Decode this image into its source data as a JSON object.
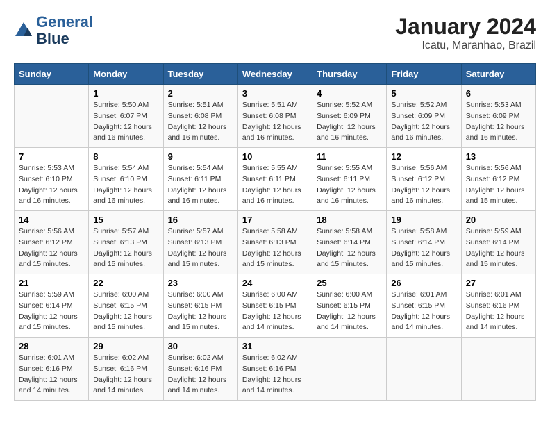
{
  "logo": {
    "line1": "General",
    "line2": "Blue"
  },
  "title": "January 2024",
  "location": "Icatu, Maranhao, Brazil",
  "days_header": [
    "Sunday",
    "Monday",
    "Tuesday",
    "Wednesday",
    "Thursday",
    "Friday",
    "Saturday"
  ],
  "weeks": [
    [
      {
        "num": "",
        "info": ""
      },
      {
        "num": "1",
        "info": "Sunrise: 5:50 AM\nSunset: 6:07 PM\nDaylight: 12 hours\nand 16 minutes."
      },
      {
        "num": "2",
        "info": "Sunrise: 5:51 AM\nSunset: 6:08 PM\nDaylight: 12 hours\nand 16 minutes."
      },
      {
        "num": "3",
        "info": "Sunrise: 5:51 AM\nSunset: 6:08 PM\nDaylight: 12 hours\nand 16 minutes."
      },
      {
        "num": "4",
        "info": "Sunrise: 5:52 AM\nSunset: 6:09 PM\nDaylight: 12 hours\nand 16 minutes."
      },
      {
        "num": "5",
        "info": "Sunrise: 5:52 AM\nSunset: 6:09 PM\nDaylight: 12 hours\nand 16 minutes."
      },
      {
        "num": "6",
        "info": "Sunrise: 5:53 AM\nSunset: 6:09 PM\nDaylight: 12 hours\nand 16 minutes."
      }
    ],
    [
      {
        "num": "7",
        "info": "Sunrise: 5:53 AM\nSunset: 6:10 PM\nDaylight: 12 hours\nand 16 minutes."
      },
      {
        "num": "8",
        "info": "Sunrise: 5:54 AM\nSunset: 6:10 PM\nDaylight: 12 hours\nand 16 minutes."
      },
      {
        "num": "9",
        "info": "Sunrise: 5:54 AM\nSunset: 6:11 PM\nDaylight: 12 hours\nand 16 minutes."
      },
      {
        "num": "10",
        "info": "Sunrise: 5:55 AM\nSunset: 6:11 PM\nDaylight: 12 hours\nand 16 minutes."
      },
      {
        "num": "11",
        "info": "Sunrise: 5:55 AM\nSunset: 6:11 PM\nDaylight: 12 hours\nand 16 minutes."
      },
      {
        "num": "12",
        "info": "Sunrise: 5:56 AM\nSunset: 6:12 PM\nDaylight: 12 hours\nand 16 minutes."
      },
      {
        "num": "13",
        "info": "Sunrise: 5:56 AM\nSunset: 6:12 PM\nDaylight: 12 hours\nand 15 minutes."
      }
    ],
    [
      {
        "num": "14",
        "info": "Sunrise: 5:56 AM\nSunset: 6:12 PM\nDaylight: 12 hours\nand 15 minutes."
      },
      {
        "num": "15",
        "info": "Sunrise: 5:57 AM\nSunset: 6:13 PM\nDaylight: 12 hours\nand 15 minutes."
      },
      {
        "num": "16",
        "info": "Sunrise: 5:57 AM\nSunset: 6:13 PM\nDaylight: 12 hours\nand 15 minutes."
      },
      {
        "num": "17",
        "info": "Sunrise: 5:58 AM\nSunset: 6:13 PM\nDaylight: 12 hours\nand 15 minutes."
      },
      {
        "num": "18",
        "info": "Sunrise: 5:58 AM\nSunset: 6:14 PM\nDaylight: 12 hours\nand 15 minutes."
      },
      {
        "num": "19",
        "info": "Sunrise: 5:58 AM\nSunset: 6:14 PM\nDaylight: 12 hours\nand 15 minutes."
      },
      {
        "num": "20",
        "info": "Sunrise: 5:59 AM\nSunset: 6:14 PM\nDaylight: 12 hours\nand 15 minutes."
      }
    ],
    [
      {
        "num": "21",
        "info": "Sunrise: 5:59 AM\nSunset: 6:14 PM\nDaylight: 12 hours\nand 15 minutes."
      },
      {
        "num": "22",
        "info": "Sunrise: 6:00 AM\nSunset: 6:15 PM\nDaylight: 12 hours\nand 15 minutes."
      },
      {
        "num": "23",
        "info": "Sunrise: 6:00 AM\nSunset: 6:15 PM\nDaylight: 12 hours\nand 15 minutes."
      },
      {
        "num": "24",
        "info": "Sunrise: 6:00 AM\nSunset: 6:15 PM\nDaylight: 12 hours\nand 14 minutes."
      },
      {
        "num": "25",
        "info": "Sunrise: 6:00 AM\nSunset: 6:15 PM\nDaylight: 12 hours\nand 14 minutes."
      },
      {
        "num": "26",
        "info": "Sunrise: 6:01 AM\nSunset: 6:15 PM\nDaylight: 12 hours\nand 14 minutes."
      },
      {
        "num": "27",
        "info": "Sunrise: 6:01 AM\nSunset: 6:16 PM\nDaylight: 12 hours\nand 14 minutes."
      }
    ],
    [
      {
        "num": "28",
        "info": "Sunrise: 6:01 AM\nSunset: 6:16 PM\nDaylight: 12 hours\nand 14 minutes."
      },
      {
        "num": "29",
        "info": "Sunrise: 6:02 AM\nSunset: 6:16 PM\nDaylight: 12 hours\nand 14 minutes."
      },
      {
        "num": "30",
        "info": "Sunrise: 6:02 AM\nSunset: 6:16 PM\nDaylight: 12 hours\nand 14 minutes."
      },
      {
        "num": "31",
        "info": "Sunrise: 6:02 AM\nSunset: 6:16 PM\nDaylight: 12 hours\nand 14 minutes."
      },
      {
        "num": "",
        "info": ""
      },
      {
        "num": "",
        "info": ""
      },
      {
        "num": "",
        "info": ""
      }
    ]
  ]
}
